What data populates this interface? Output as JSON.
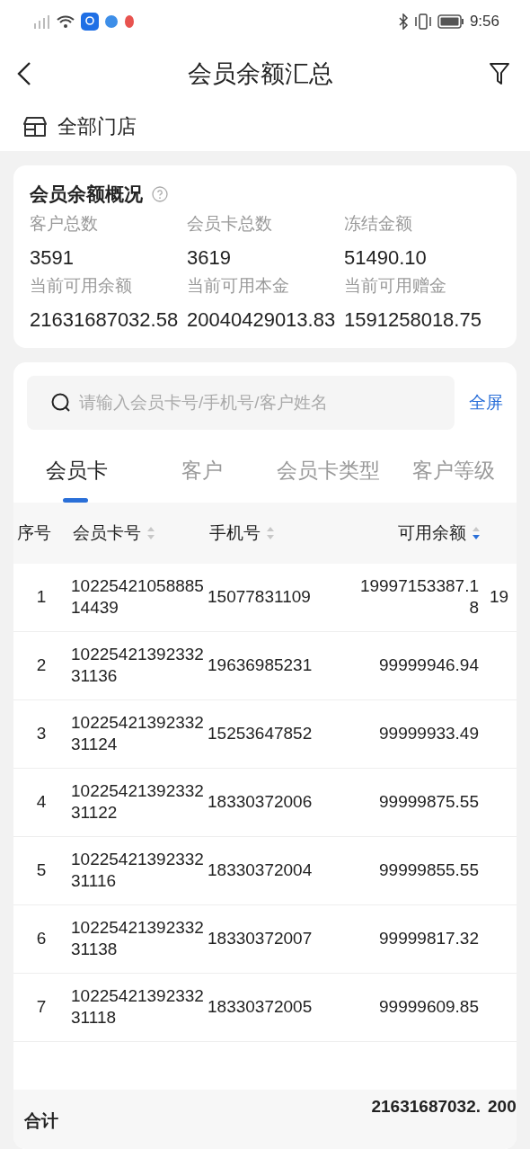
{
  "status_bar": {
    "time": "9:56"
  },
  "header": {
    "title": "会员余额汇总"
  },
  "store": {
    "label": "全部门店"
  },
  "summary": {
    "title": "会员余额概况",
    "stats": [
      {
        "label": "客户总数",
        "value": "3591"
      },
      {
        "label": "会员卡总数",
        "value": "3619"
      },
      {
        "label": "冻结金额",
        "value": "51490.10"
      },
      {
        "label": "当前可用余额",
        "value": "21631687032.58"
      },
      {
        "label": "当前可用本金",
        "value": "20040429013.83"
      },
      {
        "label": "当前可用赠金",
        "value": "1591258018.75"
      }
    ]
  },
  "search": {
    "placeholder": "请输入会员卡号/手机号/客户姓名",
    "action": "全屏"
  },
  "tabs": [
    {
      "label": "会员卡",
      "selected": true
    },
    {
      "label": "客户",
      "selected": false
    },
    {
      "label": "会员卡类型",
      "selected": false
    },
    {
      "label": "客户等级",
      "selected": false
    }
  ],
  "table": {
    "columns": [
      {
        "label": "序号",
        "sortable": false
      },
      {
        "label": "会员卡号",
        "sortable": true,
        "sorted_descending": false
      },
      {
        "label": "手机号",
        "sortable": true,
        "sorted_descending": false
      },
      {
        "label": "可用余额",
        "sortable": true,
        "sorted_descending": true
      }
    ],
    "rows": [
      {
        "index": "1",
        "card": "1022542105888514439",
        "phone": "15077831109",
        "balance": "19997153387.18",
        "column_5": "19"
      },
      {
        "index": "2",
        "card": "1022542139233231136",
        "phone": "19636985231",
        "balance": "99999946.94"
      },
      {
        "index": "3",
        "card": "1022542139233231124",
        "phone": "15253647852",
        "balance": "99999933.49"
      },
      {
        "index": "4",
        "card": "1022542139233231122",
        "phone": "18330372006",
        "balance": "99999875.55"
      },
      {
        "index": "5",
        "card": "1022542139233231116",
        "phone": "18330372004",
        "balance": "99999855.55"
      },
      {
        "index": "6",
        "card": "1022542139233231138",
        "phone": "18330372007",
        "balance": "99999817.32"
      },
      {
        "index": "7",
        "card": "1022542139233231118",
        "phone": "18330372005",
        "balance": "99999609.85"
      }
    ],
    "total": {
      "label": "合计",
      "balance": "21631687032.",
      "column_5": "200"
    }
  }
}
